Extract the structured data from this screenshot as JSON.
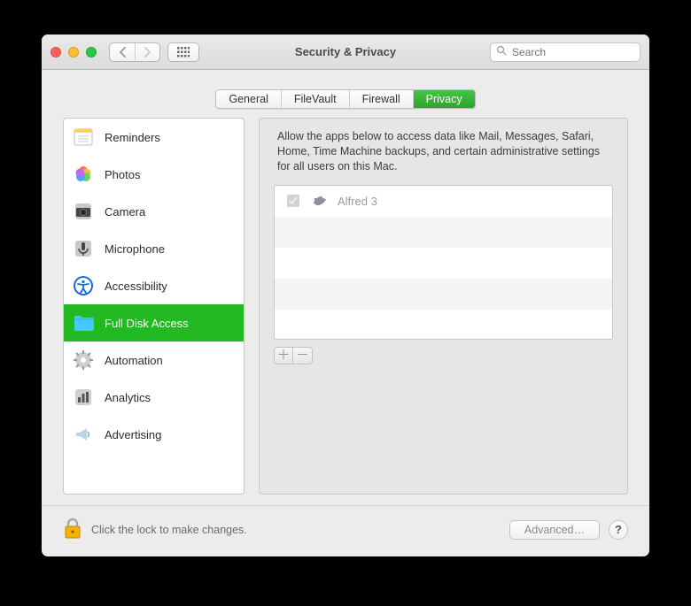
{
  "window": {
    "title": "Security & Privacy",
    "search_placeholder": "Search"
  },
  "tabs": [
    {
      "label": "General",
      "selected": false
    },
    {
      "label": "FileVault",
      "selected": false
    },
    {
      "label": "Firewall",
      "selected": false
    },
    {
      "label": "Privacy",
      "selected": true
    }
  ],
  "sidebar": {
    "items": [
      {
        "label": "Reminders",
        "icon": "reminders-icon",
        "selected": false
      },
      {
        "label": "Photos",
        "icon": "photos-icon",
        "selected": false
      },
      {
        "label": "Camera",
        "icon": "camera-icon",
        "selected": false
      },
      {
        "label": "Microphone",
        "icon": "microphone-icon",
        "selected": false
      },
      {
        "label": "Accessibility",
        "icon": "accessibility-icon",
        "selected": false
      },
      {
        "label": "Full Disk Access",
        "icon": "folder-icon",
        "selected": true
      },
      {
        "label": "Automation",
        "icon": "gear-icon",
        "selected": false
      },
      {
        "label": "Analytics",
        "icon": "barchart-icon",
        "selected": false
      },
      {
        "label": "Advertising",
        "icon": "megaphone-icon",
        "selected": false
      }
    ]
  },
  "privacy_panel": {
    "description": "Allow the apps below to access data like Mail, Messages, Safari, Home, Time Machine backups, and certain administrative settings for all users on this Mac.",
    "apps": [
      {
        "name": "Alfred 3",
        "checked": true,
        "enabled": false
      }
    ]
  },
  "footer": {
    "lock_text": "Click the lock to make changes.",
    "advanced_label": "Advanced…",
    "help_label": "?"
  }
}
